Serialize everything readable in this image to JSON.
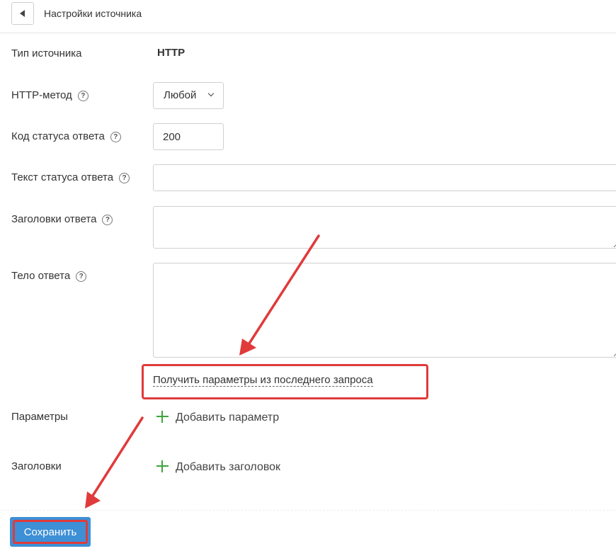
{
  "header": {
    "title": "Настройки источника"
  },
  "form": {
    "source_type_label": "Тип источника",
    "source_type_value": "HTTP",
    "http_method_label": "HTTP-метод",
    "http_method_value": "Любой",
    "status_code_label": "Код статуса ответа",
    "status_code_value": "200",
    "status_text_label": "Текст статуса ответа",
    "status_text_value": "",
    "response_headers_label": "Заголовки ответа",
    "response_headers_value": "",
    "response_body_label": "Тело ответа",
    "response_body_value": "",
    "get_params_link": "Получить параметры из последнего запроса",
    "params_label": "Параметры",
    "add_param": "Добавить параметр",
    "headers_label": "Заголовки",
    "add_header": "Добавить заголовок",
    "help_glyph": "?"
  },
  "footer": {
    "save_label": "Сохранить"
  },
  "colors": {
    "accent": "#3d8fd6",
    "annotation": "#e03a3a",
    "plus": "#3ca53c"
  }
}
